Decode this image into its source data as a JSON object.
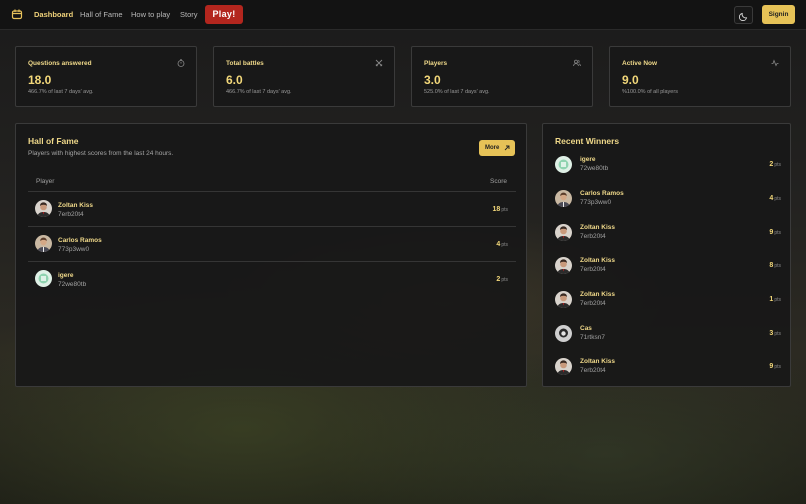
{
  "nav": {
    "links": [
      "Dashboard",
      "Hall of Fame",
      "How to play",
      "Story"
    ],
    "play_label": "Play!",
    "signin_label": "Signin"
  },
  "stats": [
    {
      "label": "Questions answered",
      "value": "18.0",
      "sub": "466.7% of last 7 days' avg.",
      "icon": "timer-icon"
    },
    {
      "label": "Total battles",
      "value": "6.0",
      "sub": "466.7% of last 7 days' avg.",
      "icon": "crossed-swords-icon"
    },
    {
      "label": "Players",
      "value": "3.0",
      "sub": "525.0% of last 7 days' avg.",
      "icon": "users-icon"
    },
    {
      "label": "Active Now",
      "value": "9.0",
      "sub": "%100.0% of all players",
      "icon": "activity-icon"
    }
  ],
  "hall_of_fame": {
    "title": "Hall of Fame",
    "subtitle": "Players with highest scores from the last 24 hours.",
    "more_label": "More",
    "col_player": "Player",
    "col_score": "Score",
    "rows": [
      {
        "name": "Zoltan Kiss",
        "id": "7erb20t4",
        "score": "18",
        "unit": "pts",
        "avatar": "zoltan"
      },
      {
        "name": "Carlos Ramos",
        "id": "773p3ww0",
        "score": "4",
        "unit": "pts",
        "avatar": "carlos"
      },
      {
        "name": "igere",
        "id": "72we80tb",
        "score": "2",
        "unit": "pts",
        "avatar": "igere"
      }
    ]
  },
  "recent_winners": {
    "title": "Recent Winners",
    "rows": [
      {
        "name": "igere",
        "id": "72we80tb",
        "score": "2",
        "unit": "pts",
        "avatar": "igere"
      },
      {
        "name": "Carlos Ramos",
        "id": "773p3ww0",
        "score": "4",
        "unit": "pts",
        "avatar": "carlos"
      },
      {
        "name": "Zoltan Kiss",
        "id": "7erb20t4",
        "score": "9",
        "unit": "pts",
        "avatar": "zoltan"
      },
      {
        "name": "Zoltan Kiss",
        "id": "7erb20t4",
        "score": "8",
        "unit": "pts",
        "avatar": "zoltan"
      },
      {
        "name": "Zoltan Kiss",
        "id": "7erb20t4",
        "score": "1",
        "unit": "pts",
        "avatar": "zoltan"
      },
      {
        "name": "Cas",
        "id": "71rtksn7",
        "score": "3",
        "unit": "pts",
        "avatar": "cas"
      },
      {
        "name": "Zoltan Kiss",
        "id": "7erb20t4",
        "score": "9",
        "unit": "pts",
        "avatar": "zoltan"
      }
    ]
  },
  "colors": {
    "accent": "#e6c257",
    "play": "#b3261e",
    "card_bg": "#181818"
  }
}
